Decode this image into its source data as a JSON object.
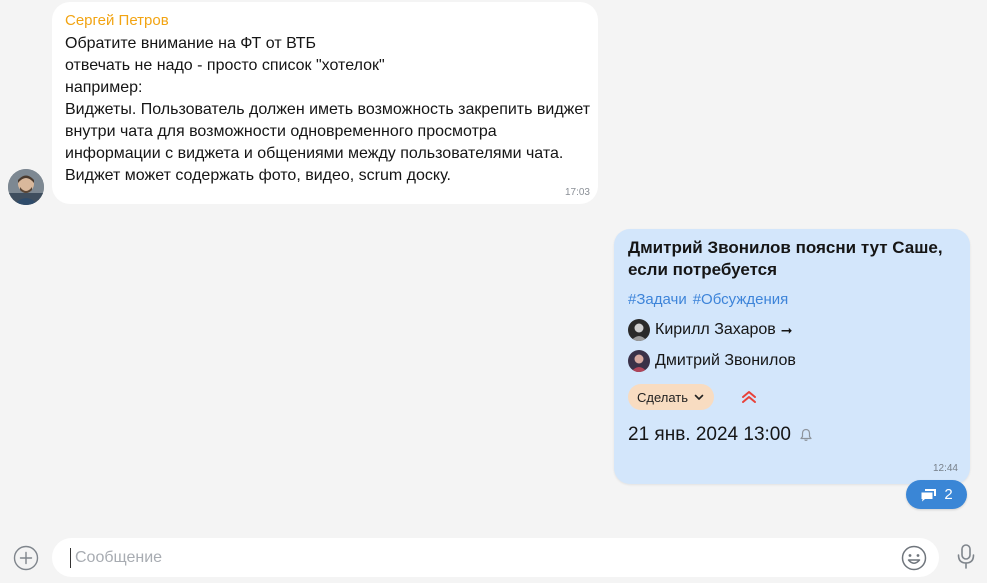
{
  "incoming": {
    "sender": "Сергей Петров",
    "lines": [
      "Обратите внимание на ФТ от ВТБ",
      "отвечать не надо - просто список \"хотелок\"",
      "например:",
      "Виджеты. Пользователь должен иметь возможность закрепить виджет",
      "внутри чата для возможности одновременного просмотра",
      "информации с виджета и общениями между пользователями чата.",
      "Виджет может содержать фото, видео, scrum доску."
    ],
    "time": "17:03"
  },
  "outgoing": {
    "title_line1": "Дмитрий Звонилов поясни тут Саше,",
    "title_line2": "если потребуется",
    "tags": [
      "#Задачи",
      "#Обсуждения"
    ],
    "assignee_from": "Кирилл Захаров",
    "arrow": "➞",
    "assignee_to": "Дмитрий Звонилов",
    "action_label": "Сделать",
    "due": "21 янв. 2024 13:00",
    "time": "12:44"
  },
  "thread": {
    "count": "2"
  },
  "composer": {
    "placeholder": "Сообщение"
  },
  "colors": {
    "sender": "#f2a413",
    "tag": "#3d84d9",
    "outgoing_bg": "#d3e6fb",
    "action_bg": "#f8dcc1",
    "priority": "#e8423a",
    "thread_badge": "#3a86d6"
  },
  "icons": [
    "user-avatar-icon",
    "priority-high-icon",
    "chevron-down-icon",
    "bell-icon",
    "thread-replies-icon",
    "add-attachment-icon",
    "emoji-icon",
    "microphone-icon"
  ]
}
